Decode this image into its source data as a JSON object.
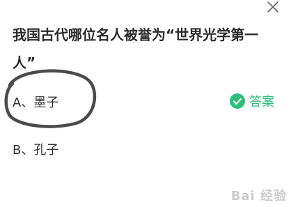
{
  "question": {
    "text": "我国古代哪位名人被誉为“世界光学第一人”"
  },
  "options": [
    {
      "label": "A、墨子"
    },
    {
      "label": "B、孔子"
    }
  ],
  "answer": {
    "label": "答案"
  },
  "watermark": {
    "text": "Bai 经验"
  },
  "colors": {
    "accent": "#2bbf7a",
    "circle": "#4a4a4a"
  }
}
